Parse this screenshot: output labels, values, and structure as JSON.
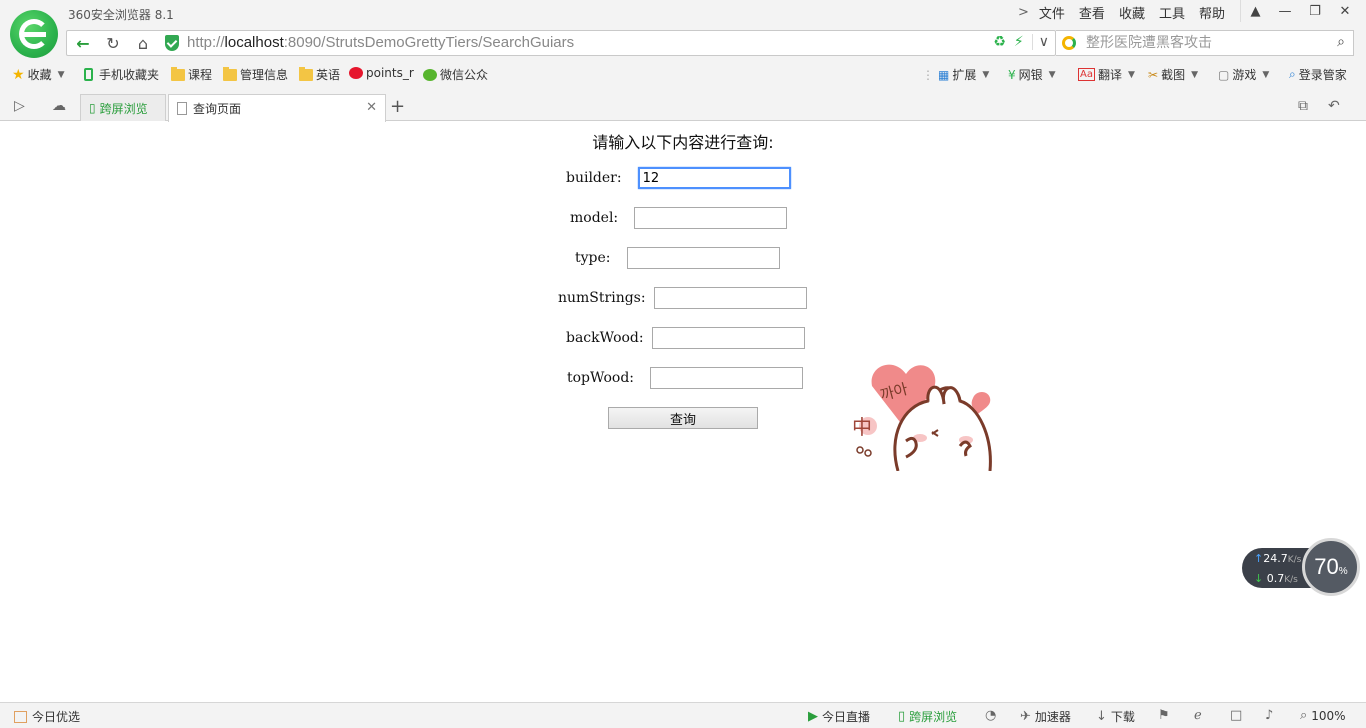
{
  "browser": {
    "title": "360安全浏览器 8.1",
    "menu": [
      "文件",
      "查看",
      "收藏",
      "工具",
      "帮助"
    ],
    "address": {
      "protocol": "http://",
      "host": "localhost",
      "path": ":8090/StrutsDemoGrettyTiers/SearchGuiars"
    },
    "search_placeholder": "整形医院遭黑客攻击",
    "bookmarks": [
      "收藏",
      "手机收藏夹",
      "课程",
      "管理信息",
      "英语",
      "points_r",
      "微信公众"
    ],
    "extensions": [
      "扩展",
      "网银",
      "翻译",
      "截图",
      "游戏",
      "登录管家"
    ],
    "tabs": [
      "跨屏浏览",
      "查询页面"
    ]
  },
  "page": {
    "heading": "请输入以下内容进行查询:",
    "fields": [
      {
        "label": "builder:",
        "value": "12"
      },
      {
        "label": "model:",
        "value": ""
      },
      {
        "label": "type:",
        "value": ""
      },
      {
        "label": "numStrings:",
        "value": ""
      },
      {
        "label": "backWood:",
        "value": ""
      },
      {
        "label": "topWood:",
        "value": ""
      }
    ],
    "submit_label": "查询",
    "sticker_text": "까아"
  },
  "speed_widget": {
    "up": "24.7",
    "down": "0.7",
    "unit": "K/s",
    "percent": "70",
    "percent_sign": "%"
  },
  "statusbar": {
    "left": "今日优选",
    "items": [
      "今日直播",
      "跨屏浏览",
      "加速器",
      "下载"
    ],
    "zoom": "100%"
  },
  "colors": {
    "brand_green": "#2bb24c",
    "focus_blue": "#4d90fe"
  }
}
